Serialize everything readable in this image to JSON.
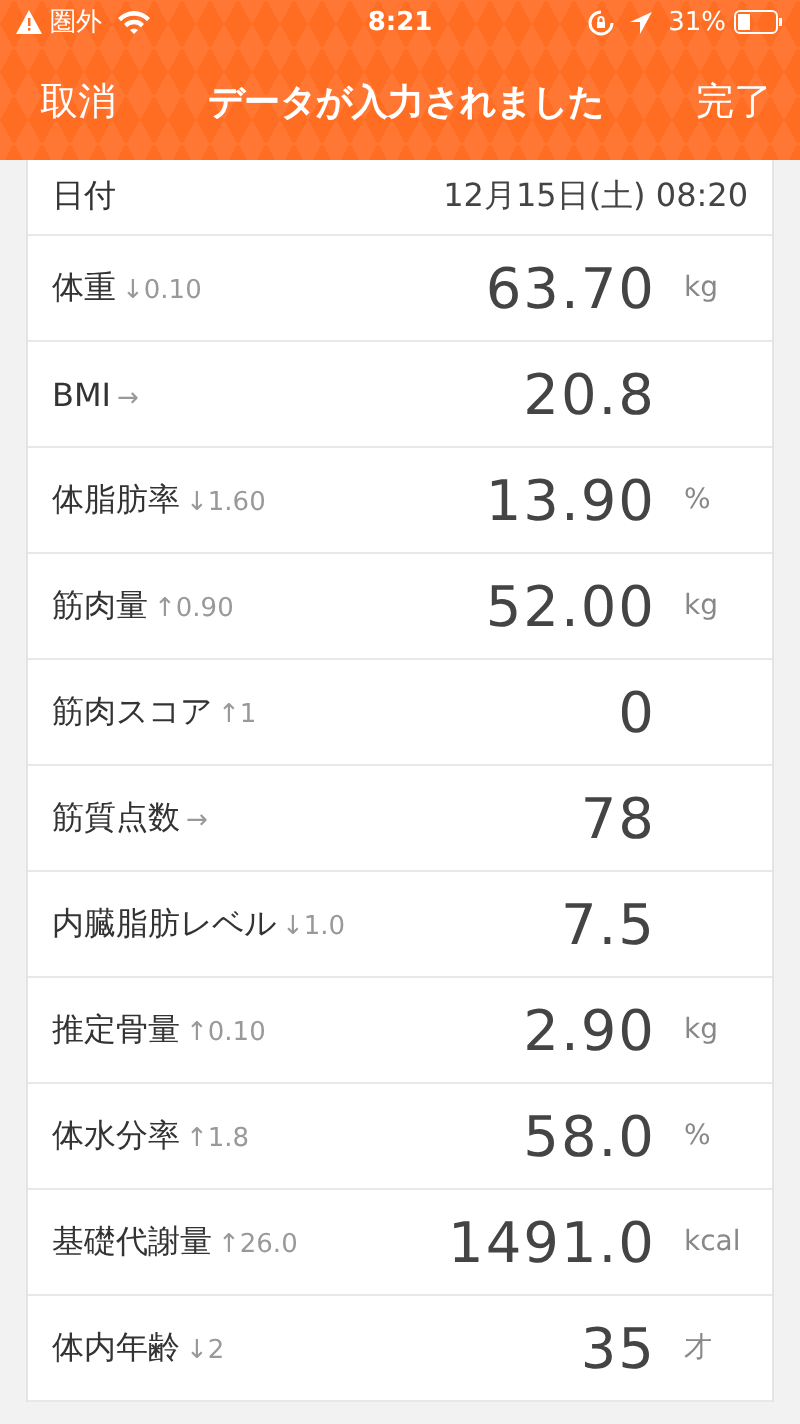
{
  "status_bar": {
    "carrier": "圏外",
    "time": "8:21",
    "battery": "31%"
  },
  "nav": {
    "cancel": "取消",
    "title": "データが入力されました",
    "done": "完了"
  },
  "date": {
    "label": "日付",
    "value": "12月15日(土) 08:20"
  },
  "rows": [
    {
      "label": "体重",
      "change": "↓0.10",
      "value": "63.70",
      "unit": "kg"
    },
    {
      "label": "BMI",
      "change": "→",
      "value": "20.8"
    },
    {
      "label": "体脂肪率",
      "change": "↓1.60",
      "value": "13.90",
      "unit": "%"
    },
    {
      "label": "筋肉量",
      "change": "↑0.90",
      "value": "52.00",
      "unit": "kg"
    },
    {
      "label": "筋肉スコア",
      "change": "↑1",
      "value": "0"
    },
    {
      "label": "筋質点数",
      "change": "→",
      "value": "78"
    },
    {
      "label": "内臓脂肪レベル",
      "change": "↓1.0",
      "value": "7.5"
    },
    {
      "label": "推定骨量",
      "change": "↑0.10",
      "value": "2.90",
      "unit": "kg"
    },
    {
      "label": "体水分率",
      "change": "↑1.8",
      "value": "58.0",
      "unit": "%"
    },
    {
      "label": "基礎代謝量",
      "change": "↑26.0",
      "value": "1491.0",
      "unit": "kcal"
    },
    {
      "label": "体内年齢",
      "change": "↓2",
      "value": "35",
      "unit": "才"
    }
  ]
}
